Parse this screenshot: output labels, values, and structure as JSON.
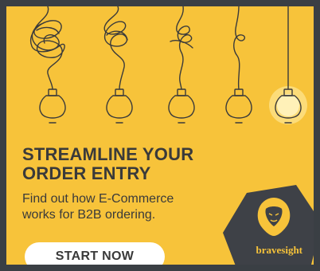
{
  "ad": {
    "headline": "STREAMLINE YOUR\nORDER ENTRY",
    "subtext": "Find out how E-Commerce\nworks for B2B ordering.",
    "cta_label": "START NOW",
    "brand_name": "bravesight"
  },
  "colors": {
    "background": "#f7c33a",
    "frame": "#3a3f44",
    "text": "#3a3a3a",
    "button": "#ffffff",
    "brand_hex": "#3e4147",
    "brand_accent": "#f7c33a"
  },
  "icons": [
    "tangled-lightbulb-icon",
    "lit-lightbulb-icon",
    "lion-logo-icon"
  ]
}
